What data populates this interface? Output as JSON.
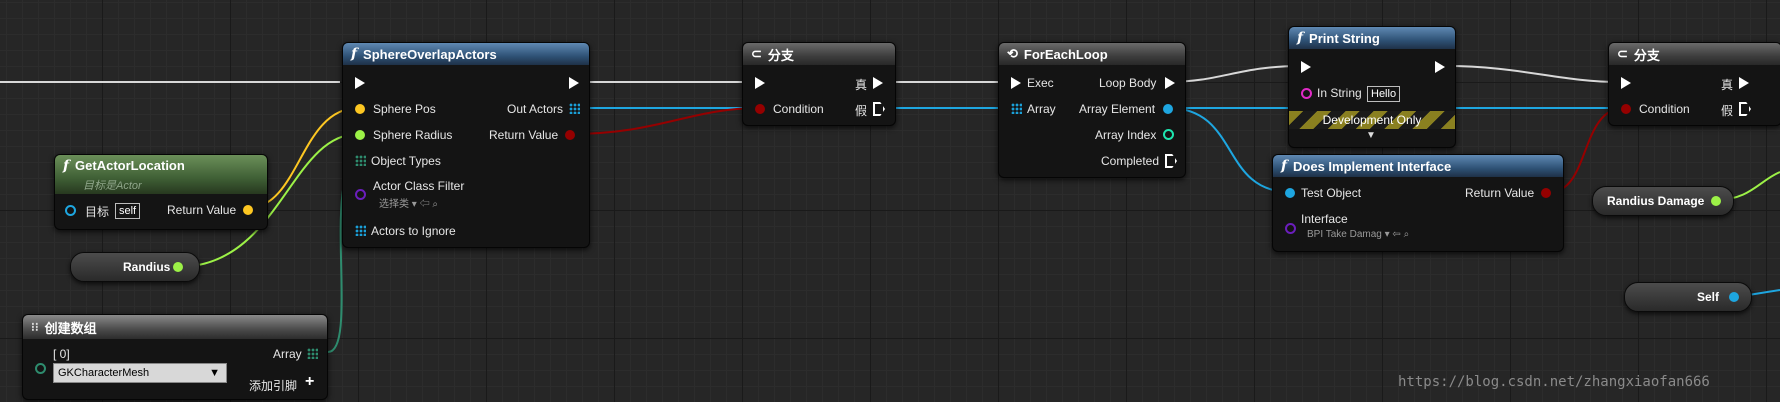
{
  "nodes": {
    "get_actor_location": {
      "title": "GetActorLocation",
      "subtitle": "目标是Actor",
      "target_label": "目标",
      "target_value": "self",
      "return_label": "Return Value"
    },
    "sphere_overlap": {
      "title": "SphereOverlapActors",
      "sphere_pos": "Sphere Pos",
      "sphere_radius": "Sphere Radius",
      "object_types": "Object Types",
      "actor_class_filter": "Actor Class Filter",
      "class_select": "选择类",
      "actors_to_ignore": "Actors to Ignore",
      "out_actors": "Out Actors",
      "return_label": "Return Value"
    },
    "branch1": {
      "title": "分支",
      "condition": "Condition",
      "true_label": "真",
      "false_label": "假"
    },
    "foreach": {
      "title": "ForEachLoop",
      "exec": "Exec",
      "array": "Array",
      "loop_body": "Loop Body",
      "array_element": "Array Element",
      "array_index": "Array Index",
      "completed": "Completed"
    },
    "print_string": {
      "title": "Print String",
      "in_string": "In String",
      "in_string_value": "Hello",
      "dev_only": "Development Only"
    },
    "does_implement": {
      "title": "Does Implement Interface",
      "test_object": "Test Object",
      "return_label": "Return Value",
      "interface": "Interface",
      "interface_value": "BPI Take Damag"
    },
    "branch2": {
      "title": "分支",
      "condition": "Condition",
      "true_label": "真",
      "false_label": "假"
    },
    "make_array": {
      "title": "创建数组",
      "index_label": "[ 0]",
      "array_label": "Array",
      "combo_value": "GKCharacterMesh",
      "add_pin": "添加引脚"
    }
  },
  "variables": {
    "radius": "Randius",
    "radius_damage": "Randius Damage",
    "self": "Self"
  },
  "watermark": "https://blog.csdn.net/zhangxiaofan666",
  "colors": {
    "exec": "#ffffff",
    "vector": "#fdc722",
    "float": "#9cf147",
    "object": "#1ea6e0",
    "bool": "#950000",
    "int": "#1ee6b0",
    "class": "#6b1ebc",
    "grid_bg": "#262626"
  }
}
